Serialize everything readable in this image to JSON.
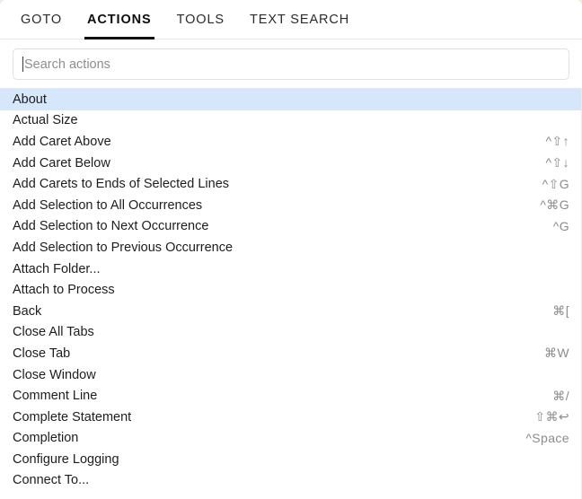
{
  "window": {
    "name": "command-palette"
  },
  "tabs": [
    {
      "label": "GOTO",
      "active": false
    },
    {
      "label": "ACTIONS",
      "active": true
    },
    {
      "label": "TOOLS",
      "active": false
    },
    {
      "label": "TEXT SEARCH",
      "active": false
    }
  ],
  "search": {
    "value": "",
    "placeholder": "Search actions"
  },
  "colors": {
    "selection": "#d7e7fb",
    "active_tab_underline": "#111111",
    "shortcut_text": "#8c8c8c"
  },
  "results": [
    {
      "label": "About",
      "shortcut": "",
      "selected": true
    },
    {
      "label": "Actual Size",
      "shortcut": "",
      "selected": false
    },
    {
      "label": "Add Caret Above",
      "shortcut": "^⇧↑",
      "selected": false
    },
    {
      "label": "Add Caret Below",
      "shortcut": "^⇧↓",
      "selected": false
    },
    {
      "label": "Add Carets to Ends of Selected Lines",
      "shortcut": "^⇧G",
      "selected": false
    },
    {
      "label": "Add Selection to All Occurrences",
      "shortcut": "^⌘G",
      "selected": false
    },
    {
      "label": "Add Selection to Next Occurrence",
      "shortcut": "^G",
      "selected": false
    },
    {
      "label": "Add Selection to Previous Occurrence",
      "shortcut": "",
      "selected": false
    },
    {
      "label": "Attach Folder...",
      "shortcut": "",
      "selected": false
    },
    {
      "label": "Attach to Process",
      "shortcut": "",
      "selected": false
    },
    {
      "label": "Back",
      "shortcut": "⌘[",
      "selected": false
    },
    {
      "label": "Close All Tabs",
      "shortcut": "",
      "selected": false
    },
    {
      "label": "Close Tab",
      "shortcut": "⌘W",
      "selected": false
    },
    {
      "label": "Close Window",
      "shortcut": "",
      "selected": false
    },
    {
      "label": "Comment Line",
      "shortcut": "⌘/",
      "selected": false
    },
    {
      "label": "Complete Statement",
      "shortcut": "⇧⌘↩",
      "selected": false
    },
    {
      "label": "Completion",
      "shortcut": "^Space",
      "selected": false
    },
    {
      "label": "Configure Logging",
      "shortcut": "",
      "selected": false
    },
    {
      "label": "Connect To...",
      "shortcut": "",
      "selected": false
    }
  ]
}
